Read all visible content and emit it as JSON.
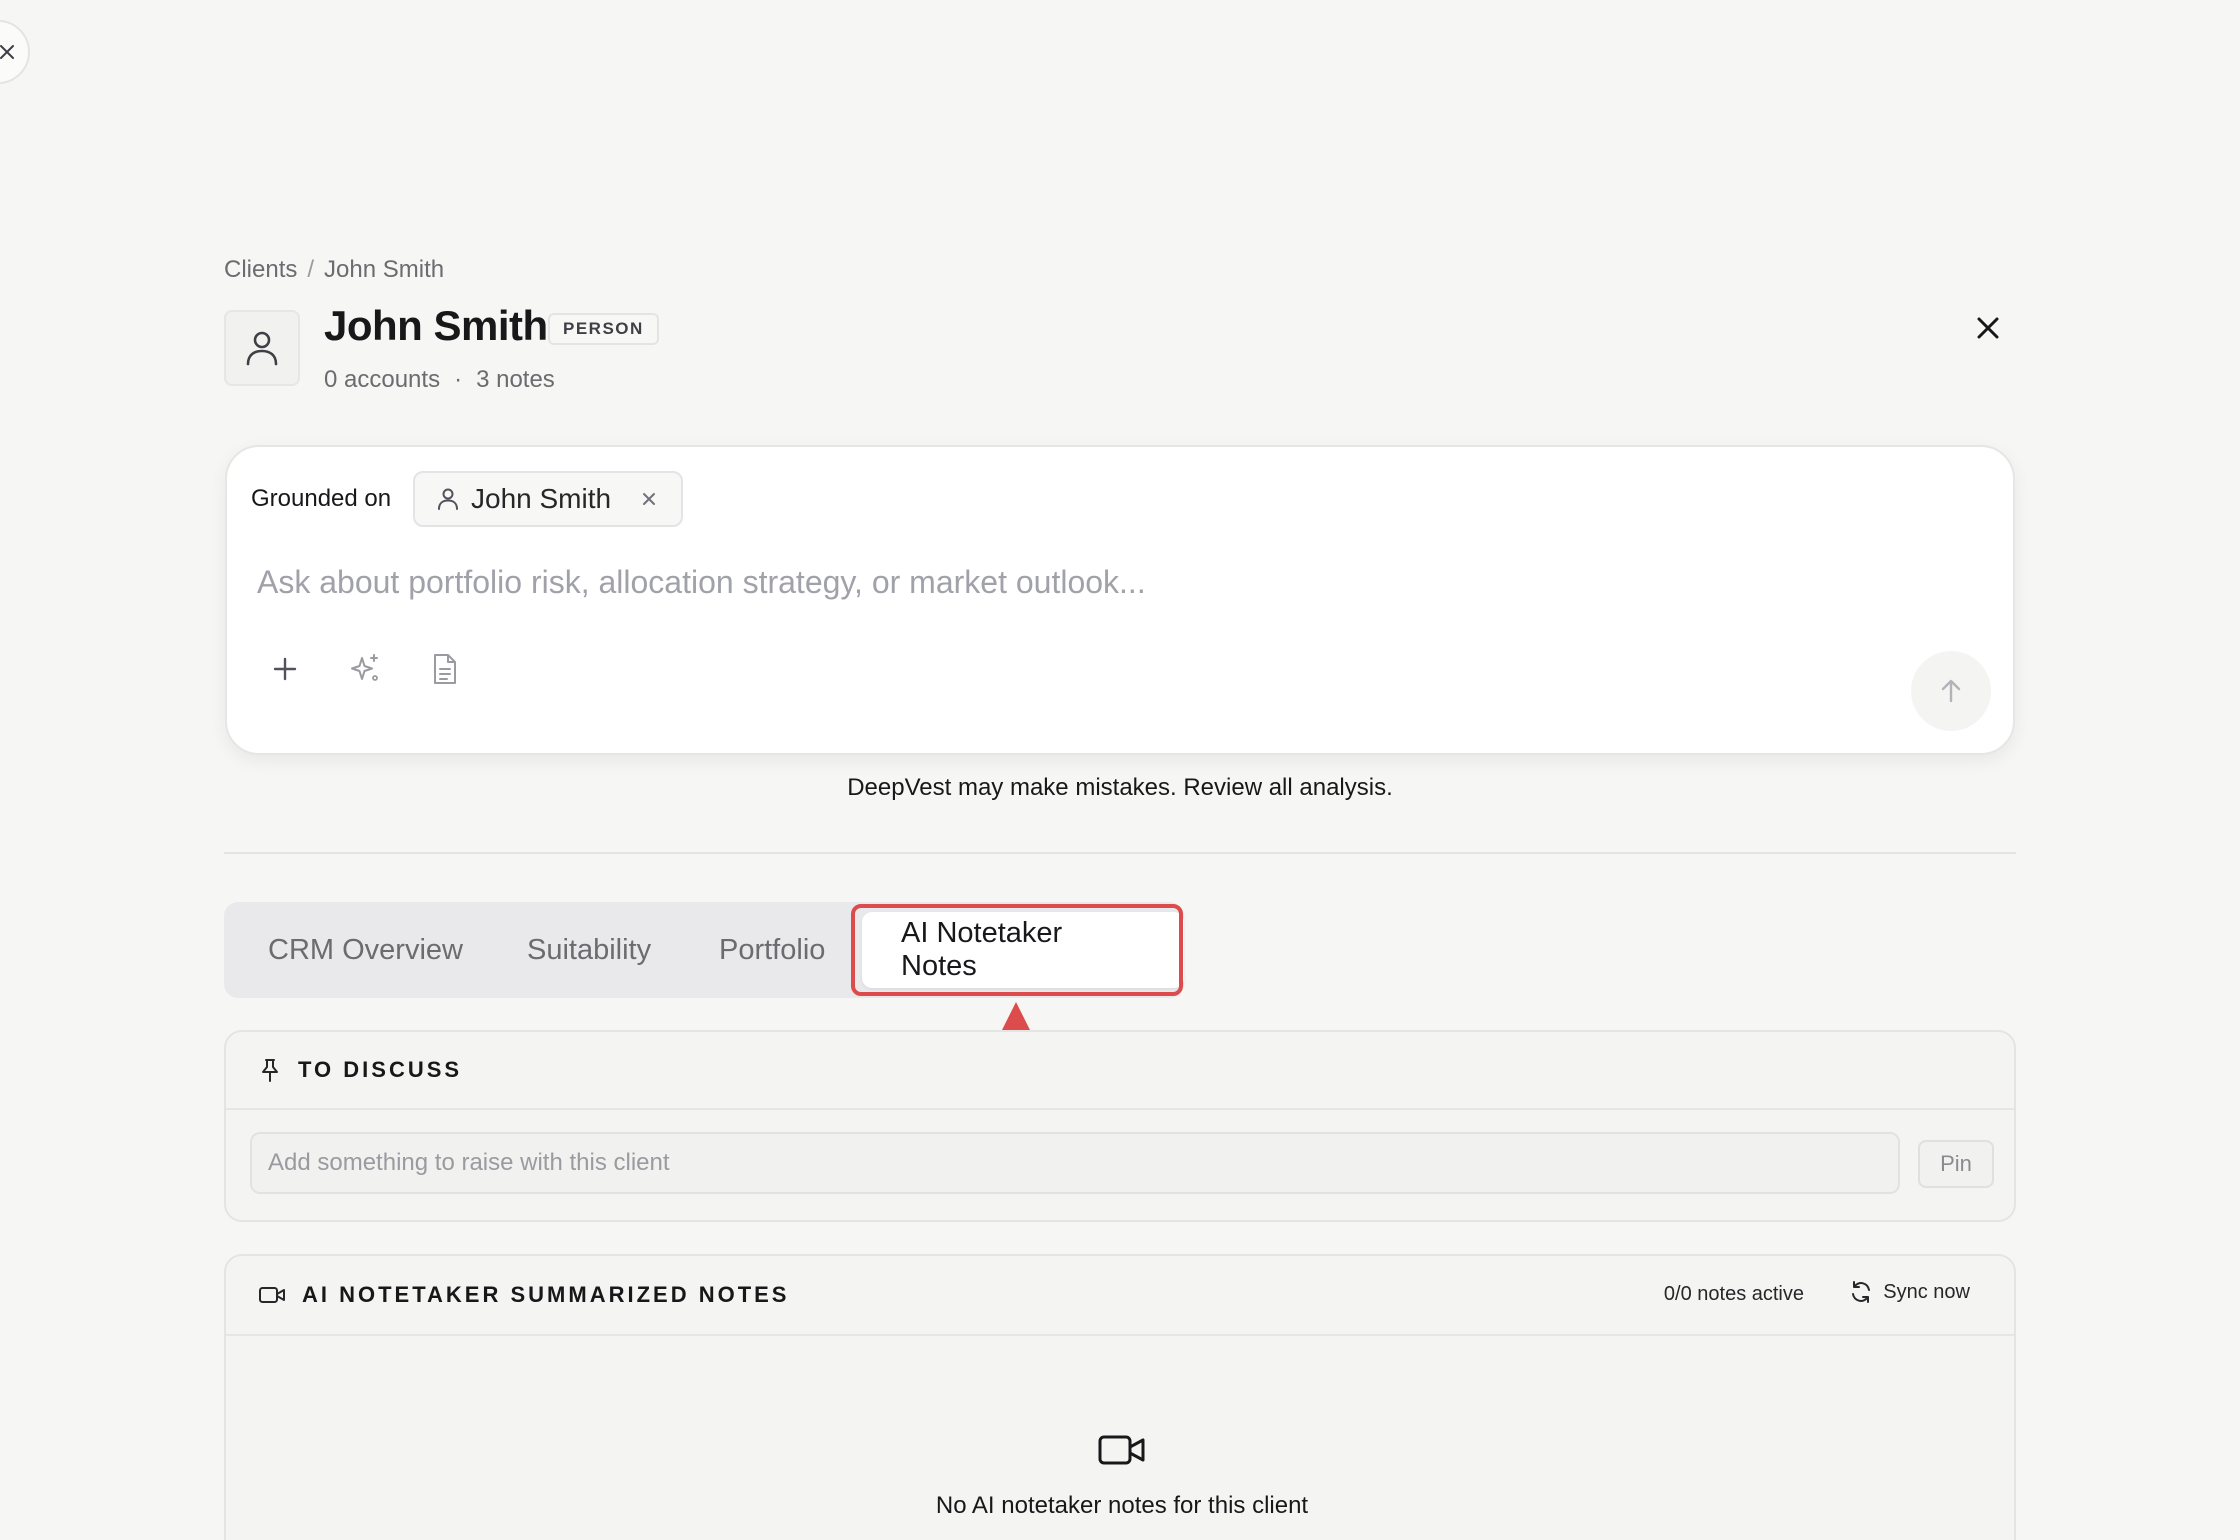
{
  "breadcrumb": {
    "root": "Clients",
    "separator": "/",
    "current": "John Smith"
  },
  "client": {
    "name": "John Smith",
    "type_badge": "PERSON",
    "accounts": "0 accounts",
    "meta_separator": "·",
    "notes": "3 notes",
    "avatar_icon": "user-icon"
  },
  "composer": {
    "grounded_label": "Grounded on",
    "grounded_chip": "John Smith",
    "placeholder": "Ask about portfolio risk, allocation strategy, or market outlook...",
    "tools": [
      "plus-icon",
      "sparkles-icon",
      "document-icon"
    ],
    "send_icon": "arrow-up-icon"
  },
  "disclaimer": "DeepVest may make mistakes. Review all analysis.",
  "tabs": [
    {
      "label": "CRM Overview",
      "active": false
    },
    {
      "label": "Suitability",
      "active": false
    },
    {
      "label": "Portfolio",
      "active": false
    },
    {
      "label": "AI Notetaker Notes",
      "active": true
    }
  ],
  "to_discuss": {
    "title": "TO DISCUSS",
    "icon": "pin-icon",
    "placeholder": "Add something to raise with this client",
    "pin_label": "Pin"
  },
  "ai_notes": {
    "title": "AI NOTETAKER SUMMARIZED NOTES",
    "icon": "video-icon",
    "active_count": "0/0 notes active",
    "sync_label": "Sync now",
    "empty_text": "No AI notetaker notes for this client"
  },
  "colors": {
    "background": "#f6f6f4",
    "highlight": "#dc4c4c",
    "tab_bar": "#e9e9ec"
  }
}
